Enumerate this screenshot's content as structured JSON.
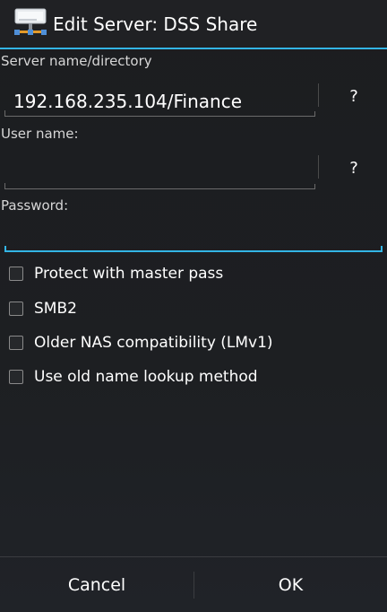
{
  "dialog": {
    "title": "Edit Server: DSS Share",
    "icon": "network-server-icon"
  },
  "fields": {
    "server": {
      "label": "Server name/directory",
      "value": "192.168.235.104/Finance",
      "help_label": "?"
    },
    "username": {
      "label": "User name:",
      "value": "",
      "help_label": "?"
    },
    "password": {
      "label": "Password:",
      "value": ""
    }
  },
  "options": [
    {
      "label": "Protect with master pass",
      "checked": false
    },
    {
      "label": "SMB2",
      "checked": false
    },
    {
      "label": "Older NAS compatibility (LMv1)",
      "checked": false
    },
    {
      "label": "Use old name lookup method",
      "checked": false
    }
  ],
  "buttons": {
    "cancel": "Cancel",
    "ok": "OK"
  },
  "colors": {
    "accent": "#33b5e5",
    "background": "#1c1d20",
    "text": "#ffffff"
  }
}
